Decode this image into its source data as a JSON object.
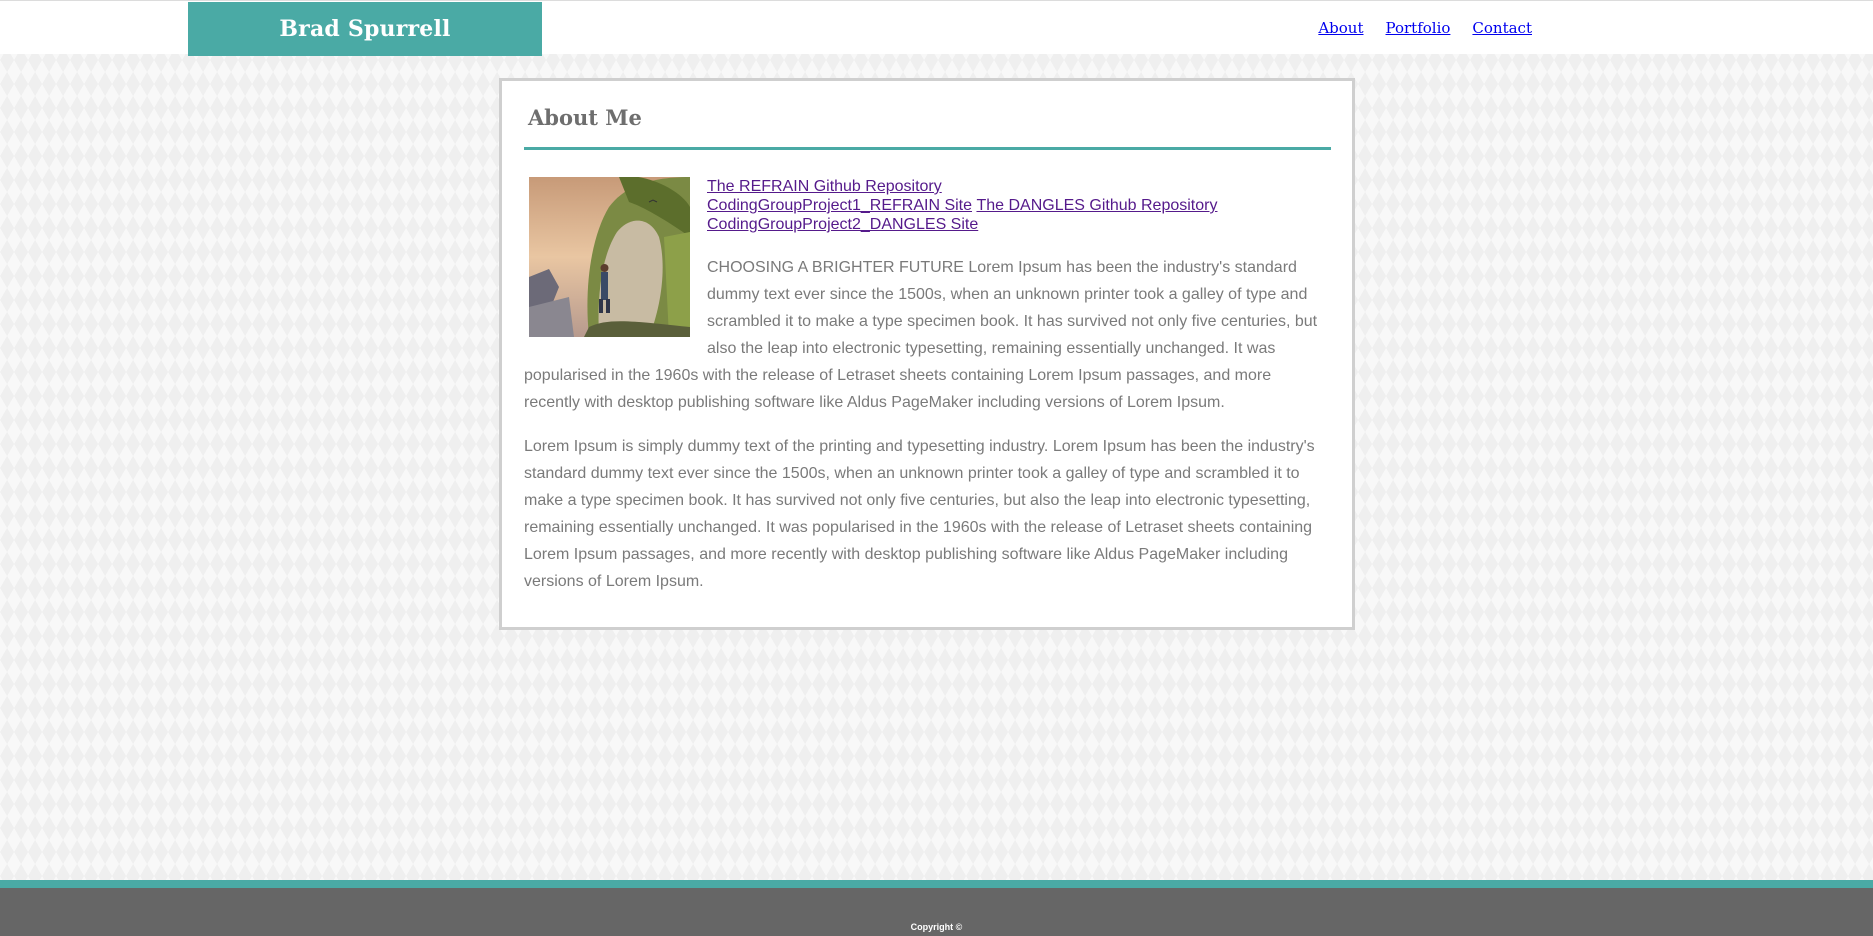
{
  "header": {
    "brand": "Brad Spurrell",
    "nav": [
      {
        "label": "About"
      },
      {
        "label": "Portfolio"
      },
      {
        "label": "Contact"
      }
    ]
  },
  "about": {
    "title": "About Me",
    "links": [
      {
        "label": "The REFRAIN Github Repository"
      },
      {
        "label": "CodingGroupProject1_REFRAIN Site"
      },
      {
        "label": "The DANGLES Github Repository"
      },
      {
        "label": "CodingGroupProject2_DANGLES Site"
      }
    ],
    "paragraphs": [
      "CHOOSING A BRIGHTER FUTURE Lorem Ipsum has been the industry's standard dummy text ever since the 1500s, when an unknown printer took a galley of type and scrambled it to make a type specimen book. It has survived not only five centuries, but also the leap into electronic typesetting, remaining essentially unchanged. It was popularised in the 1960s with the release of Letraset sheets containing Lorem Ipsum passages, and more recently with desktop publishing software like Aldus PageMaker including versions of Lorem Ipsum.",
      "Lorem Ipsum is simply dummy text of the printing and typesetting industry. Lorem Ipsum has been the industry's standard dummy text ever since the 1500s, when an unknown printer took a galley of type and scrambled it to make a type specimen book. It has survived not only five centuries, but also the leap into electronic typesetting, remaining essentially unchanged. It was popularised in the 1960s with the release of Letraset sheets containing Lorem Ipsum passages, and more recently with desktop publishing software like Aldus PageMaker including versions of Lorem Ipsum."
    ]
  },
  "footer": {
    "copyright": "Copyright ©"
  },
  "colors": {
    "accent": "#4aaaa5",
    "footer": "#666666",
    "text": "#7a7a7a",
    "link": "#551a8b",
    "nav_link": "#0000ee"
  }
}
